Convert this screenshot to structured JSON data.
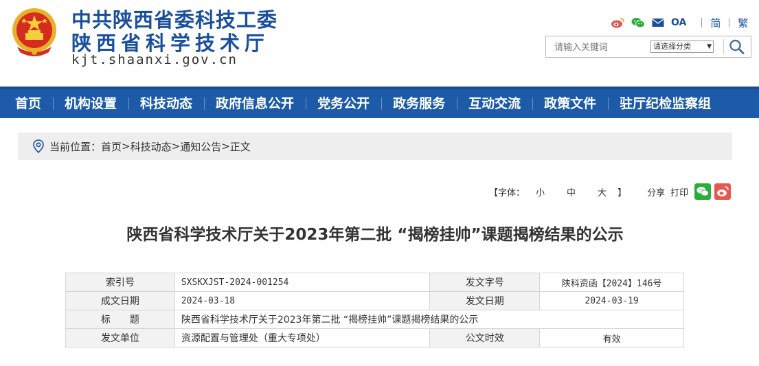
{
  "header": {
    "title_line1": "中共陕西省委科技工委",
    "title_line2": "陕西省科学技术厅",
    "domain": "kjt.shaanxi.gov.cn",
    "icons": [
      "weibo-icon",
      "wechat-icon",
      "mail-icon"
    ],
    "oa_label": "OA",
    "lang_simplified": "简",
    "lang_traditional": "繁",
    "search": {
      "placeholder": "请输入关键词",
      "category_select": "请选择分类"
    }
  },
  "nav": {
    "items": [
      "首页",
      "机构设置",
      "科技动态",
      "政府信息公开",
      "党务公开",
      "政务服务",
      "互动交流",
      "政策文件",
      "驻厅纪检监察组"
    ]
  },
  "breadcrumb": {
    "prefix": "当前位置：",
    "items": [
      "首页",
      "科技动态",
      "通知公告",
      "正文"
    ],
    "separator": " > "
  },
  "tools": {
    "font_label": "【字体：",
    "font_small": "小",
    "font_medium": "中",
    "font_large": "大",
    "font_end": "】",
    "share_label": "分享",
    "print_label": "打印"
  },
  "article": {
    "title": "陕西省科学技术厅关于2023年第二批 “揭榜挂帅”课题揭榜结果的公示"
  },
  "meta": {
    "index_label": "索引号",
    "index_value": "SXSKXJST-2024-001254",
    "doc_no_label": "发文字号",
    "doc_no_value": "陕科资函【2024】146号",
    "created_label": "成文日期",
    "created_value": "2024-03-18",
    "issued_label": "发文日期",
    "issued_value": "2024-03-19",
    "subject_label": "标　　题",
    "subject_value": "陕西省科学技术厅关于2023年第二批 “揭榜挂帅”课题揭榜结果的公示",
    "issuer_label": "发文单位",
    "issuer_value": "资源配置与管理处（重大专项处）",
    "validity_label": "公文时效",
    "validity_value": "有效"
  },
  "colors": {
    "brand_blue": "#1d5ba8",
    "title_blue": "#1a4f9c",
    "wechat_green": "#2bad3a",
    "weibo_red": "#e6574e"
  }
}
